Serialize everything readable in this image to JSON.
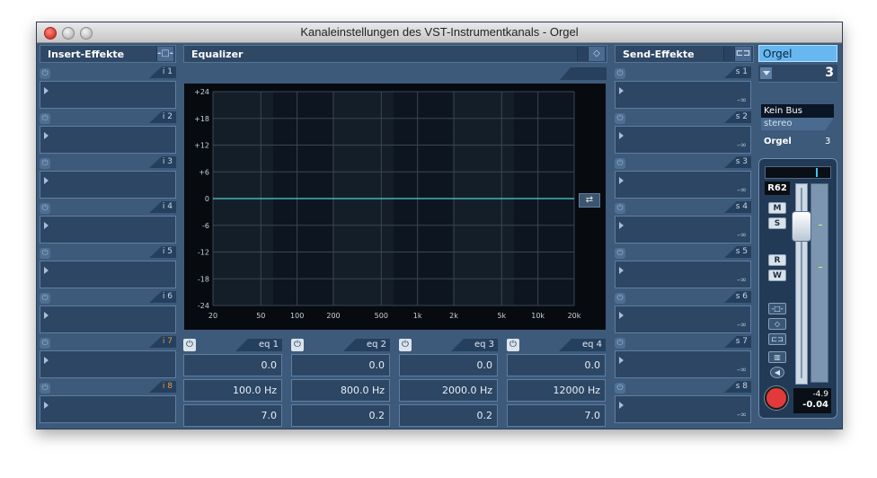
{
  "window": {
    "title": "Kanaleinstellungen des VST-Instrumentkanals - Orgel"
  },
  "insert": {
    "header": "Insert-Effekte",
    "header_icon": "insert-bypass-icon",
    "slots": [
      {
        "label": "i 1"
      },
      {
        "label": "i 2"
      },
      {
        "label": "i 3"
      },
      {
        "label": "i 4"
      },
      {
        "label": "i 5"
      },
      {
        "label": "i 6"
      },
      {
        "label": "i 7",
        "color": "#e89a3a"
      },
      {
        "label": "i 8",
        "color": "#e89a3a"
      }
    ]
  },
  "equalizer": {
    "header": "Equalizer",
    "header_icon": "eq-bypass-icon",
    "y_ticks": [
      "+24",
      "+18",
      "+12",
      "+6",
      "0",
      "-6",
      "-12",
      "-18",
      "-24"
    ],
    "x_ticks": [
      "20",
      "50",
      "100",
      "200",
      "500",
      "1k",
      "2k",
      "5k",
      "10k",
      "20k"
    ],
    "x_tick_freqs": [
      20,
      50,
      100,
      200,
      500,
      1000,
      2000,
      5000,
      10000,
      20000
    ],
    "y_range": [
      -24,
      24
    ],
    "x_range": [
      20,
      20000
    ],
    "x_scale": "log",
    "curve_db": 0,
    "curve_color": "#4fd2c8",
    "reset_icon": "loop-reset-icon",
    "bands": [
      {
        "label": "eq 1",
        "gain": "0.0",
        "freq": "100.0 Hz",
        "q": "7.0"
      },
      {
        "label": "eq 2",
        "gain": "0.0",
        "freq": "800.0 Hz",
        "q": "0.2"
      },
      {
        "label": "eq 3",
        "gain": "0.0",
        "freq": "2000.0 Hz",
        "q": "0.2"
      },
      {
        "label": "eq 4",
        "gain": "0.0",
        "freq": "12000 Hz",
        "q": "7.0"
      }
    ]
  },
  "send": {
    "header": "Send-Effekte",
    "header_icon": "send-bypass-icon",
    "slots": [
      {
        "label": "s 1",
        "value": "-∞"
      },
      {
        "label": "s 2",
        "value": "-∞"
      },
      {
        "label": "s 3",
        "value": "-∞"
      },
      {
        "label": "s 4",
        "value": "-∞"
      },
      {
        "label": "s 5",
        "value": "-∞"
      },
      {
        "label": "s 6",
        "value": "-∞"
      },
      {
        "label": "s 7",
        "value": "-∞"
      },
      {
        "label": "s 8",
        "value": "-∞"
      }
    ]
  },
  "channel": {
    "name": "Orgel",
    "number": "3",
    "routing": "Kein Bus",
    "config": "stereo",
    "output_name": "Orgel",
    "output_num": "3",
    "pan": "R62",
    "mute": "M",
    "solo": "S",
    "read": "R",
    "write": "W",
    "level_peak": "-4.9",
    "level_volume": "-0.04",
    "fader_level": 0.86,
    "accent": "#67b8f0"
  }
}
